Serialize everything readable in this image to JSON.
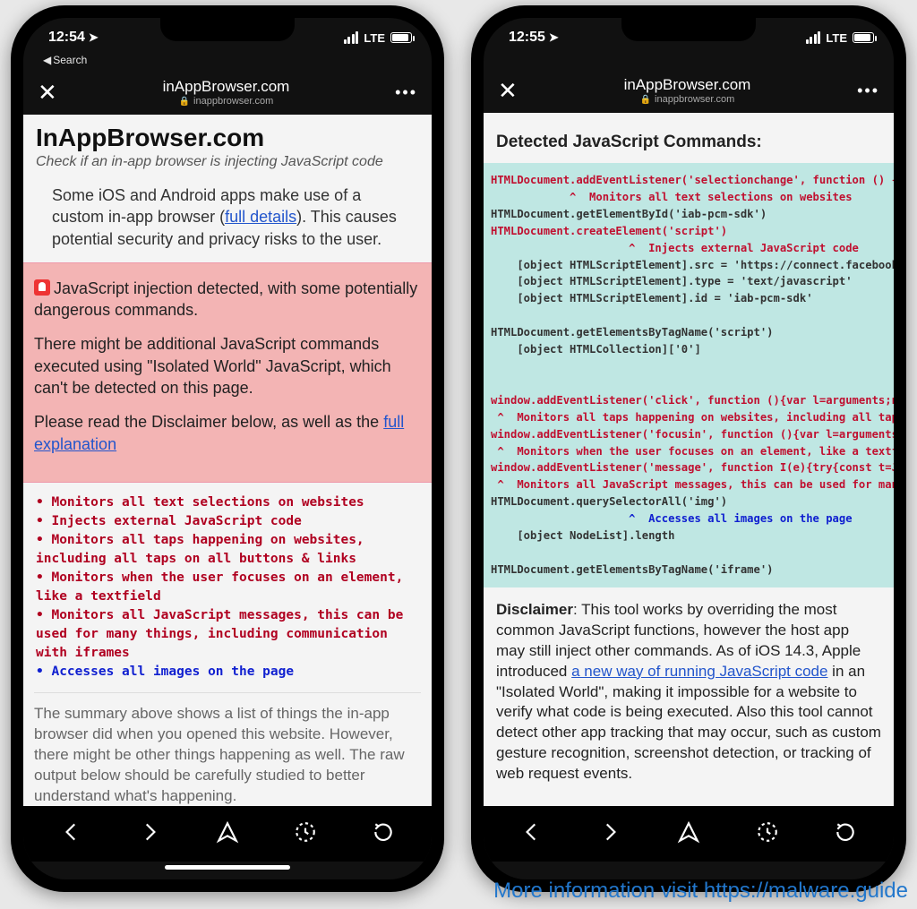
{
  "phones": {
    "left": {
      "status": {
        "time": "12:54",
        "back": "Search",
        "carrier": "LTE"
      },
      "nav": {
        "title": "inAppBrowser.com",
        "domain": "inappbrowser.com"
      },
      "page": {
        "h1": "InAppBrowser.com",
        "tagline": "Check if an in-app browser is injecting JavaScript code",
        "intro_a": "Some iOS and Android apps make use of a custom in-app browser (",
        "intro_link": "full details",
        "intro_b": "). This causes potential security and privacy risks to the user.",
        "alert": {
          "p1": "JavaScript injection detected, with some potentially dangerous commands.",
          "p2": "There might be additional JavaScript commands executed using \"Isolated World\" JavaScript, which can't be detected on this page.",
          "p3a": "Please read the Disclaimer below, as well as the ",
          "p3_link": "full explanation"
        },
        "bullets": [
          "Monitors all text selections on websites",
          "Injects external JavaScript code",
          "Monitors all taps happening on websites, including all taps on all buttons & links",
          "Monitors when the user focuses on an element, like a textfield",
          "Monitors all JavaScript messages, this can be used for many things, including communication with iframes",
          "Accesses all images on the page"
        ],
        "summary": "The summary above shows a list of things the in-app browser did when you opened this website. However, there might be other things happening as well. The raw output below should be carefully studied to better understand what's happening."
      }
    },
    "right": {
      "status": {
        "time": "12:55",
        "carrier": "LTE"
      },
      "nav": {
        "title": "inAppBrowser.com",
        "domain": "inappbrowser.com"
      },
      "page": {
        "heading": "Detected JavaScript Commands:",
        "code": {
          "l1": "HTMLDocument.addEventListener('selectionchange', function () {",
          "l2": "            ^  Monitors all text selections on websites",
          "l3": "HTMLDocument.getElementById('iab-pcm-sdk')",
          "l4": "HTMLDocument.createElement('script')",
          "l5": "                     ^  Injects external JavaScript code",
          "l6": "    [object HTMLScriptElement].src = 'https://connect.facebook",
          "l7": "    [object HTMLScriptElement].type = 'text/javascript'",
          "l8": "    [object HTMLScriptElement].id = 'iab-pcm-sdk'",
          "l9": "",
          "l10": "HTMLDocument.getElementsByTagName('script')",
          "l11": "    [object HTMLCollection]['0']",
          "l12": "",
          "l13": "",
          "l14": "window.addEventListener('click', function (){var l=arguments;n",
          "l15": " ^  Monitors all taps happening on websites, including all tap",
          "l16": "window.addEventListener('focusin', function (){var l=arguments",
          "l17": " ^  Monitors when the user focuses on an element, like a textf",
          "l18": "window.addEventListener('message', function I(e){try{const t=J",
          "l19": " ^  Monitors all JavaScript messages, this can be used for man",
          "l20": "HTMLDocument.querySelectorAll('img')",
          "l21": "                     ^  Accesses all images on the page",
          "l22": "    [object NodeList].length",
          "l23": "",
          "l24": "HTMLDocument.getElementsByTagName('iframe')"
        },
        "disclaimer": {
          "label": "Disclaimer",
          "t1": ": This tool works by overriding the most common JavaScript functions, however the host app may still inject other commands. As of iOS 14.3, Apple introduced ",
          "link": "a new way of running JavaScript code",
          "t2": " in an \"Isolated World\", making it impossible for a website to verify what code is being executed. Also this tool cannot detect other app tracking that may occur, such as custom gesture recognition, screenshot detection, or tracking of web request events."
        }
      }
    }
  },
  "watermark": "More information visit https://malware.guide"
}
